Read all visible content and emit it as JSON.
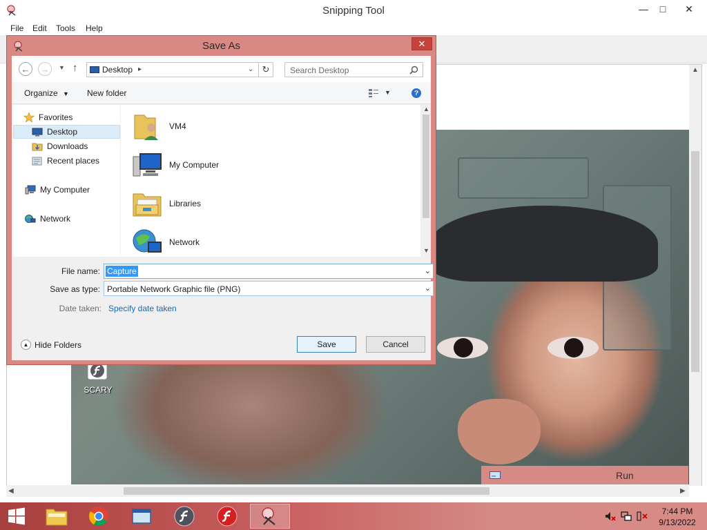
{
  "app": {
    "title": "Snipping Tool",
    "menu": [
      "File",
      "Edit",
      "Tools",
      "Help"
    ]
  },
  "desktop_icon": {
    "label": "SCARY"
  },
  "run_bar": {
    "label": "Run"
  },
  "dialog": {
    "title": "Save As",
    "address": {
      "location": "Desktop"
    },
    "search": {
      "placeholder": "Search Desktop"
    },
    "commands": {
      "organize": "Organize",
      "new_folder": "New folder"
    },
    "nav_tree": [
      {
        "label": "Favorites",
        "icon": "star-icon"
      },
      {
        "label": "Desktop",
        "icon": "desktop-icon",
        "selected": true
      },
      {
        "label": "Downloads",
        "icon": "downloads-icon"
      },
      {
        "label": "Recent places",
        "icon": "recent-places-icon"
      },
      {
        "label": "My Computer",
        "icon": "computer-icon"
      },
      {
        "label": "Network",
        "icon": "network-icon"
      }
    ],
    "items": [
      {
        "label": "VM4",
        "icon": "user-folder-icon"
      },
      {
        "label": "My Computer",
        "icon": "computer-icon"
      },
      {
        "label": "Libraries",
        "icon": "libraries-icon"
      },
      {
        "label": "Network",
        "icon": "network-icon"
      }
    ],
    "form": {
      "file_name_label": "File name:",
      "file_name_value": "Capture",
      "save_type_label": "Save as type:",
      "save_type_value": "Portable Network Graphic file (PNG)",
      "date_taken_label": "Date taken:",
      "date_taken_link": "Specify date taken"
    },
    "hide_folders": "Hide Folders",
    "save": "Save",
    "cancel": "Cancel"
  },
  "taskbar": {
    "clock_time": "7:44 PM",
    "clock_date": "9/13/2022"
  },
  "colors": {
    "dialog_frame": "#d98883",
    "close_button": "#c7423a",
    "selection": "#3399ff",
    "link": "#1c67b5",
    "taskbar": "#c86060"
  }
}
